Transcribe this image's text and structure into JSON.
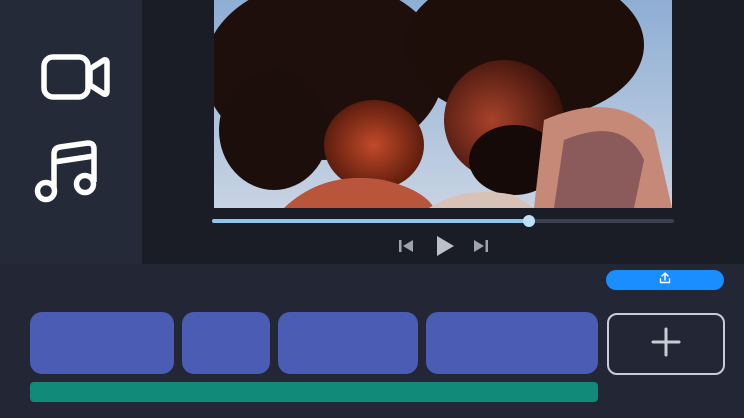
{
  "sidebar": {
    "items": [
      {
        "icon": "video-camera-icon"
      },
      {
        "icon": "music-note-icon"
      }
    ]
  },
  "preview": {
    "progress": 0.686
  },
  "controls": {
    "icons": [
      "skip-back-icon",
      "play-icon",
      "skip-forward-icon"
    ]
  },
  "toolbar": {
    "upload_icon": "upload-icon"
  },
  "timeline": {
    "clips_count": 4,
    "add_icon": "plus-icon",
    "colors": {
      "clip": "#4a5cb3",
      "audio": "#128a7a",
      "accent": "#1a8dff"
    }
  }
}
